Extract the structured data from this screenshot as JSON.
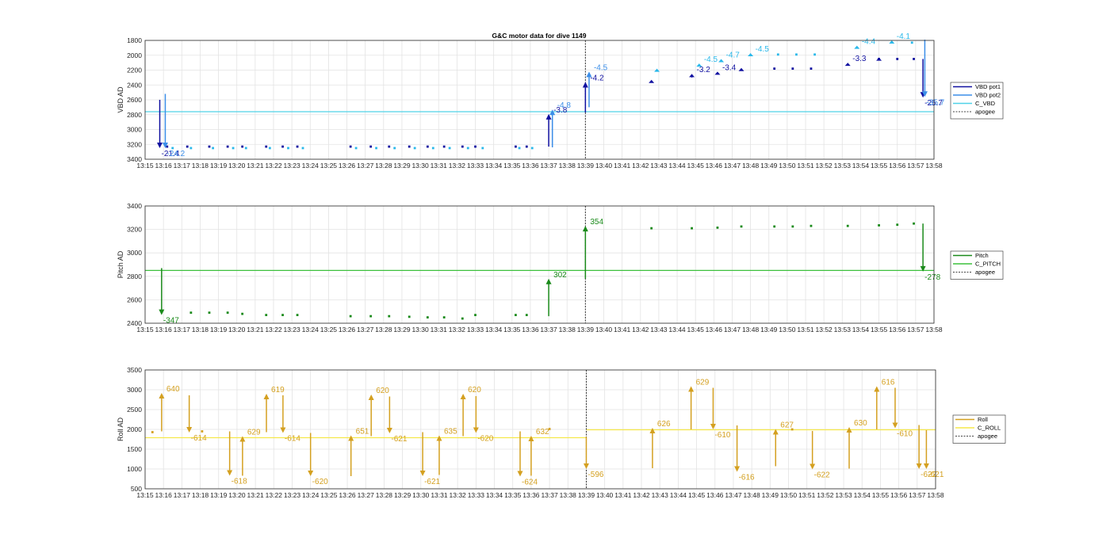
{
  "chart_data": [
    {
      "id": "vbd",
      "type": "scatter",
      "title": "G&C motor data for dive 1149",
      "ylabel": "VBD AD",
      "ylim": [
        1800,
        3400
      ],
      "y_reversed": true,
      "yticks": [
        1800,
        2000,
        2200,
        2400,
        2600,
        2800,
        3000,
        3200,
        3400
      ],
      "xlim": [
        "13:15",
        "13:58"
      ],
      "xticks": [
        "13:15",
        "13:16",
        "13:17",
        "13:18",
        "13:19",
        "13:20",
        "13:21",
        "13:22",
        "13:23",
        "13:24",
        "13:25",
        "13:26",
        "13:27",
        "13:28",
        "13:29",
        "13:30",
        "13:31",
        "13:32",
        "13:33",
        "13:34",
        "13:35",
        "13:36",
        "13:37",
        "13:38",
        "13:39",
        "13:40",
        "13:41",
        "13:42",
        "13:43",
        "13:44",
        "13:45",
        "13:46",
        "13:47",
        "13:48",
        "13:49",
        "13:50",
        "13:51",
        "13:52",
        "13:53",
        "13:54",
        "13:55",
        "13:56",
        "13:57",
        "13:58"
      ],
      "grid": true,
      "legend": {
        "placement": "outside-right",
        "entries": [
          "VBD pot1",
          "VBD pot2",
          "C_VBD",
          "apogee"
        ]
      },
      "apogee": "13:39",
      "reference_lines": [
        {
          "name": "C_VBD",
          "color": "#4fd2e8",
          "segments": [
            {
              "x0": "13:15",
              "x1": "13:58",
              "y": 2760
            }
          ]
        }
      ],
      "series": [
        {
          "name": "VBD pot1",
          "color": "#1010a0",
          "points": [
            [
              "13:16.2",
              3230
            ],
            [
              "13:17.3",
              3230
            ],
            [
              "13:18.5",
              3230
            ],
            [
              "13:19.5",
              3230
            ],
            [
              "13:20.3",
              3230
            ],
            [
              "13:21.6",
              3230
            ],
            [
              "13:22.5",
              3230
            ],
            [
              "13:23.3",
              3230
            ],
            [
              "13:26.2",
              3230
            ],
            [
              "13:27.3",
              3230
            ],
            [
              "13:28.3",
              3230
            ],
            [
              "13:29.4",
              3230
            ],
            [
              "13:30.4",
              3230
            ],
            [
              "13:31.3",
              3230
            ],
            [
              "13:32.3",
              3230
            ],
            [
              "13:33.0",
              3230
            ],
            [
              "13:35.2",
              3230
            ],
            [
              "13:35.8",
              3230
            ],
            [
              "13:49.3",
              2180
            ],
            [
              "13:50.3",
              2180
            ],
            [
              "13:51.3",
              2180
            ],
            [
              "13:55.0",
              2050
            ],
            [
              "13:56.0",
              2050
            ],
            [
              "13:56.9",
              2050
            ]
          ],
          "arrows": [
            {
              "x": "13:15.8",
              "from": 2600,
              "to": 3250,
              "label": "-21.4"
            },
            {
              "x": "13:37.0",
              "from": 3230,
              "to": 2790,
              "label": "-3.8"
            },
            {
              "x": "13:39.0",
              "from": 2770,
              "to": 2360,
              "label": "-4.2"
            },
            {
              "x": "13:42.6",
              "from": 2360,
              "to": 2330,
              "label": ""
            },
            {
              "x": "13:44.8",
              "from": 2300,
              "to": 2250,
              "label": "-3.2"
            },
            {
              "x": "13:46.2",
              "from": 2250,
              "to": 2220,
              "label": "-3.4"
            },
            {
              "x": "13:47.5",
              "from": 2200,
              "to": 2170,
              "label": ""
            },
            {
              "x": "13:53.3",
              "from": 2130,
              "to": 2100,
              "label": "-3.3"
            },
            {
              "x": "13:55.0",
              "from": 2060,
              "to": 2030,
              "label": ""
            },
            {
              "x": "13:57.4",
              "from": 2050,
              "to": 2570,
              "label": "-25.7"
            }
          ]
        },
        {
          "name": "VBD pot2",
          "color": "#3b8ee8",
          "points": [],
          "arrows": [
            {
              "x": "13:16.1",
              "from": 2520,
              "to": 3250,
              "label": "-24.2"
            },
            {
              "x": "13:37.2",
              "from": 3240,
              "to": 2730,
              "label": "-4.8"
            },
            {
              "x": "13:39.2",
              "from": 2700,
              "to": 2220,
              "label": "-4.5"
            },
            {
              "x": "13:57.5",
              "from": 1790,
              "to": 2560,
              "label": "-35.7"
            }
          ]
        },
        {
          "name": "VBD pot2 (readings)",
          "color": "#29b8ea",
          "points": [
            [
              "13:16.5",
              3250
            ],
            [
              "13:17.5",
              3250
            ],
            [
              "13:18.7",
              3250
            ],
            [
              "13:19.8",
              3250
            ],
            [
              "13:20.5",
              3250
            ],
            [
              "13:21.8",
              3250
            ],
            [
              "13:22.8",
              3250
            ],
            [
              "13:23.6",
              3250
            ],
            [
              "13:26.5",
              3250
            ],
            [
              "13:27.6",
              3250
            ],
            [
              "13:28.6",
              3250
            ],
            [
              "13:29.7",
              3250
            ],
            [
              "13:30.7",
              3250
            ],
            [
              "13:31.6",
              3250
            ],
            [
              "13:32.6",
              3250
            ],
            [
              "13:33.4",
              3250
            ],
            [
              "13:35.4",
              3250
            ],
            [
              "13:36.1",
              3250
            ],
            [
              "13:49.5",
              1990
            ],
            [
              "13:50.5",
              1990
            ],
            [
              "13:51.5",
              1990
            ],
            [
              "13:56.8",
              1830
            ]
          ],
          "arrows": [
            {
              "x": "13:42.9",
              "from": 2210,
              "to": 2180,
              "label": ""
            },
            {
              "x": "13:45.2",
              "from": 2140,
              "to": 2110,
              "label": "-4.5"
            },
            {
              "x": "13:46.4",
              "from": 2080,
              "to": 2050,
              "label": "-4.7"
            },
            {
              "x": "13:48.0",
              "from": 2000,
              "to": 1970,
              "label": "-4.5"
            },
            {
              "x": "13:53.8",
              "from": 1900,
              "to": 1870,
              "label": "-4.4"
            },
            {
              "x": "13:55.7",
              "from": 1830,
              "to": 1800,
              "label": "-4.1"
            }
          ]
        }
      ]
    },
    {
      "id": "pitch",
      "type": "scatter",
      "title": "",
      "ylabel": "Pitch AD",
      "ylim": [
        2400,
        3400
      ],
      "y_reversed": false,
      "yticks": [
        2400,
        2600,
        2800,
        3000,
        3200,
        3400
      ],
      "xlim": [
        "13:15",
        "13:58"
      ],
      "xticks": [
        "13:15",
        "13:16",
        "13:17",
        "13:18",
        "13:19",
        "13:20",
        "13:21",
        "13:22",
        "13:23",
        "13:24",
        "13:25",
        "13:26",
        "13:27",
        "13:28",
        "13:29",
        "13:30",
        "13:31",
        "13:32",
        "13:33",
        "13:34",
        "13:35",
        "13:36",
        "13:37",
        "13:38",
        "13:39",
        "13:40",
        "13:41",
        "13:42",
        "13:43",
        "13:44",
        "13:45",
        "13:46",
        "13:47",
        "13:48",
        "13:49",
        "13:50",
        "13:51",
        "13:52",
        "13:53",
        "13:54",
        "13:55",
        "13:56",
        "13:57",
        "13:58"
      ],
      "grid": true,
      "legend": {
        "placement": "outside-right",
        "entries": [
          "Pitch",
          "C_PITCH",
          "apogee"
        ]
      },
      "apogee": "13:39",
      "reference_lines": [
        {
          "name": "C_PITCH",
          "color": "#3cc03c",
          "segments": [
            {
              "x0": "13:15",
              "x1": "13:58",
              "y": 2850
            }
          ]
        }
      ],
      "series": [
        {
          "name": "Pitch",
          "color": "#1a8a1a",
          "points": [
            [
              "13:17.5",
              2490
            ],
            [
              "13:18.5",
              2490
            ],
            [
              "13:19.5",
              2490
            ],
            [
              "13:20.3",
              2480
            ],
            [
              "13:21.6",
              2470
            ],
            [
              "13:22.5",
              2470
            ],
            [
              "13:23.3",
              2470
            ],
            [
              "13:26.2",
              2460
            ],
            [
              "13:27.3",
              2460
            ],
            [
              "13:28.3",
              2460
            ],
            [
              "13:29.4",
              2455
            ],
            [
              "13:30.4",
              2450
            ],
            [
              "13:31.3",
              2450
            ],
            [
              "13:32.3",
              2440
            ],
            [
              "13:33.0",
              2470
            ],
            [
              "13:35.2",
              2470
            ],
            [
              "13:35.8",
              2470
            ],
            [
              "13:42.6",
              3210
            ],
            [
              "13:44.8",
              3210
            ],
            [
              "13:46.2",
              3215
            ],
            [
              "13:47.5",
              3225
            ],
            [
              "13:49.3",
              3225
            ],
            [
              "13:50.3",
              3225
            ],
            [
              "13:51.3",
              3230
            ],
            [
              "13:53.3",
              3230
            ],
            [
              "13:55.0",
              3235
            ],
            [
              "13:56.0",
              3240
            ],
            [
              "13:56.9",
              3250
            ]
          ],
          "arrows": [
            {
              "x": "13:15.9",
              "from": 2870,
              "to": 2470,
              "label": "-347"
            },
            {
              "x": "13:37.0",
              "from": 2460,
              "to": 2780,
              "label": "302"
            },
            {
              "x": "13:39.0",
              "from": 2780,
              "to": 3230,
              "label": "354"
            },
            {
              "x": "13:57.4",
              "from": 3250,
              "to": 2840,
              "label": "-278"
            }
          ]
        }
      ]
    },
    {
      "id": "roll",
      "type": "scatter",
      "title": "",
      "ylabel": "Roll AD",
      "ylim": [
        500,
        3500
      ],
      "y_reversed": false,
      "yticks": [
        500,
        1000,
        1500,
        2000,
        2500,
        3000,
        3500
      ],
      "xlim": [
        "13:15",
        "13:58"
      ],
      "xticks": [
        "13:15",
        "13:16",
        "13:17",
        "13:18",
        "13:19",
        "13:20",
        "13:21",
        "13:22",
        "13:23",
        "13:24",
        "13:25",
        "13:26",
        "13:27",
        "13:28",
        "13:29",
        "13:30",
        "13:31",
        "13:32",
        "13:33",
        "13:34",
        "13:35",
        "13:36",
        "13:37",
        "13:38",
        "13:39",
        "13:40",
        "13:41",
        "13:42",
        "13:43",
        "13:44",
        "13:45",
        "13:46",
        "13:47",
        "13:48",
        "13:49",
        "13:50",
        "13:51",
        "13:52",
        "13:53",
        "13:54",
        "13:55",
        "13:56",
        "13:57",
        "13:58"
      ],
      "grid": true,
      "legend": {
        "placement": "outside-right",
        "entries": [
          "Roll",
          "C_ROLL",
          "apogee"
        ]
      },
      "apogee": "13:39",
      "reference_lines": [
        {
          "name": "C_ROLL",
          "color": "#f5e84a",
          "segments": [
            {
              "x0": "13:15",
              "x1": "13:39",
              "y": 1790
            },
            {
              "x0": "13:39",
              "x1": "13:58",
              "y": 1990
            }
          ]
        }
      ],
      "series": [
        {
          "name": "Roll",
          "color": "#d4a020",
          "points": [
            [
              "13:15.4",
              1930
            ],
            [
              "13:18.1",
              1950
            ],
            [
              "13:37.0",
              2010
            ],
            [
              "13:50.2",
              2000
            ]
          ],
          "arrows": [
            {
              "x": "13:15.9",
              "from": 1950,
              "to": 2920,
              "label": "640"
            },
            {
              "x": "13:17.4",
              "from": 2860,
              "to": 1920,
              "label": "-614"
            },
            {
              "x": "13:19.6",
              "from": 1950,
              "to": 830,
              "label": "-618"
            },
            {
              "x": "13:20.3",
              "from": 830,
              "to": 1830,
              "label": "629"
            },
            {
              "x": "13:21.6",
              "from": 1930,
              "to": 2900,
              "label": "619"
            },
            {
              "x": "13:22.5",
              "from": 2860,
              "to": 1910,
              "label": "-614"
            },
            {
              "x": "13:24.0",
              "from": 1910,
              "to": 820,
              "label": "-620"
            },
            {
              "x": "13:26.2",
              "from": 820,
              "to": 1850,
              "label": "651"
            },
            {
              "x": "13:27.3",
              "from": 1830,
              "to": 2880,
              "label": "620"
            },
            {
              "x": "13:28.3",
              "from": 2830,
              "to": 1900,
              "label": "-621"
            },
            {
              "x": "13:30.1",
              "from": 1930,
              "to": 820,
              "label": "-621"
            },
            {
              "x": "13:31.0",
              "from": 850,
              "to": 1850,
              "label": "635"
            },
            {
              "x": "13:32.3",
              "from": 1830,
              "to": 2900,
              "label": "620"
            },
            {
              "x": "13:33.0",
              "from": 2840,
              "to": 1910,
              "label": "-620"
            },
            {
              "x": "13:35.4",
              "from": 1950,
              "to": 810,
              "label": "-624"
            },
            {
              "x": "13:36.0",
              "from": 830,
              "to": 1840,
              "label": "632"
            },
            {
              "x": "13:39.0",
              "from": 1810,
              "to": 1000,
              "label": "-596"
            },
            {
              "x": "13:42.6",
              "from": 1020,
              "to": 2040,
              "label": "626"
            },
            {
              "x": "13:44.7",
              "from": 2000,
              "to": 3090,
              "label": "629"
            },
            {
              "x": "13:45.9",
              "from": 3050,
              "to": 2000,
              "label": "-610"
            },
            {
              "x": "13:47.2",
              "from": 2100,
              "to": 930,
              "label": "-616"
            },
            {
              "x": "13:49.3",
              "from": 1070,
              "to": 2010,
              "label": "627"
            },
            {
              "x": "13:51.3",
              "from": 1960,
              "to": 990,
              "label": "-622"
            },
            {
              "x": "13:53.3",
              "from": 1010,
              "to": 2060,
              "label": "630"
            },
            {
              "x": "13:54.8",
              "from": 2000,
              "to": 3090,
              "label": "616"
            },
            {
              "x": "13:55.8",
              "from": 3050,
              "to": 2030,
              "label": "-610"
            },
            {
              "x": "13:57.1",
              "from": 2110,
              "to": 1000,
              "label": "-622"
            },
            {
              "x": "13:57.5",
              "from": 1980,
              "to": 1000,
              "label": "-621"
            }
          ]
        }
      ]
    }
  ]
}
